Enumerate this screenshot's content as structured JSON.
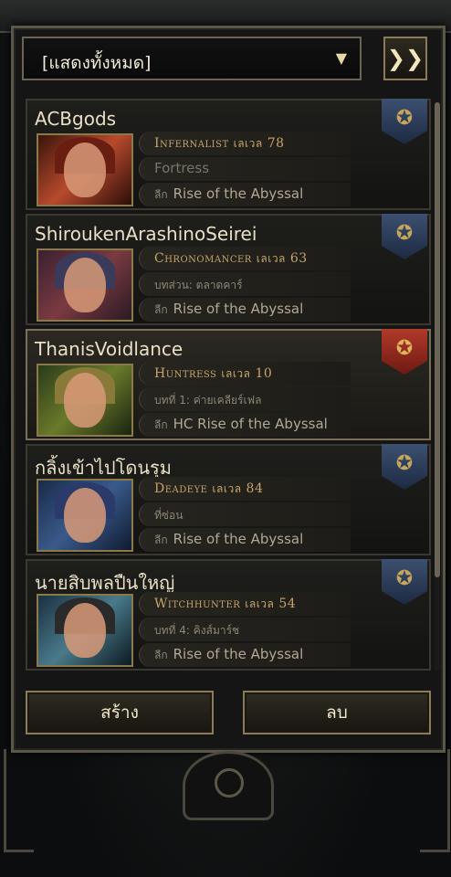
{
  "filter": {
    "label": "[แสดงทั้งหมด]",
    "arrow_icon": "▼"
  },
  "expand_icon": "❯❯",
  "characters": [
    {
      "name": "ACBgods",
      "class": "Infernalist",
      "level_label": "เลเวล",
      "level": "78",
      "location": "Fortress",
      "league_label": "ลีก",
      "league": "Rise of the Abyssal",
      "banner": "blue",
      "portrait_colors": [
        "#3a140c",
        "#b84a2c",
        "#2a0e08"
      ],
      "hair_color": "#6a1e12"
    },
    {
      "name": "ShiroukenArashinoSeirei",
      "class": "Chronomancer",
      "level_label": "เลเวล",
      "level": "63",
      "location": "บทส่วน: ตลาดคาร์",
      "league_label": "ลีก",
      "league": "Rise of the Abyssal",
      "banner": "blue",
      "portrait_colors": [
        "#3a2030",
        "#7a3a40",
        "#2a1a24"
      ],
      "hair_color": "#3a3a5a"
    },
    {
      "name": "ThanisVoidlance",
      "class": "Huntress",
      "level_label": "เลเวล",
      "level": "10",
      "location": "บทที่ 1: ค่ายเคลียร์เฟล",
      "league_label": "ลีก",
      "league": "HC Rise of the Abyssal",
      "banner": "red",
      "portrait_colors": [
        "#2a3a1a",
        "#6a7a2a",
        "#1a2410"
      ],
      "hair_color": "#8a7a3a"
    },
    {
      "name": "กลิ้งเข้าไปโดนรุม",
      "class": "Deadeye",
      "level_label": "เลเวล",
      "level": "84",
      "location": "ที่ซ่อน",
      "league_label": "ลีก",
      "league": "Rise of the Abyssal",
      "banner": "blue",
      "portrait_colors": [
        "#1a2a4a",
        "#3a5a8a",
        "#101a30"
      ],
      "hair_color": "#2a3a6a"
    },
    {
      "name": "นายสิบพลปืนใหญ่",
      "class": "Witchhunter",
      "level_label": "เลเวล",
      "level": "54",
      "location": "บทที่ 4: คิงส์มาร์ช",
      "league_label": "ลีก",
      "league": "Rise of the Abyssal",
      "banner": "blue",
      "portrait_colors": [
        "#1a3040",
        "#4a7a8a",
        "#0c1a22"
      ],
      "hair_color": "#2a2a2a"
    }
  ],
  "selected_index": 2,
  "buttons": {
    "create": "สร้าง",
    "delete": "ลบ"
  },
  "banner_icon": "✪"
}
